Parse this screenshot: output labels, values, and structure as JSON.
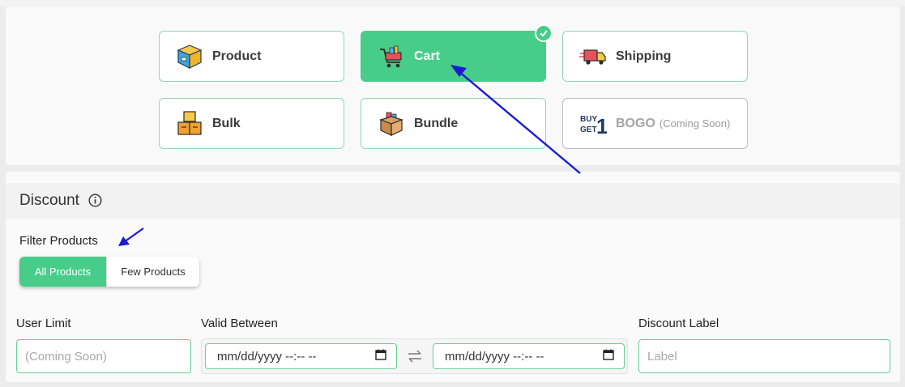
{
  "type_cards": [
    {
      "label": "Product",
      "icon": "box-icon"
    },
    {
      "label": "Cart",
      "icon": "shopping-cart-icon",
      "active": true
    },
    {
      "label": "Shipping",
      "icon": "delivery-truck-icon"
    },
    {
      "label": "Bulk",
      "icon": "stacked-boxes-icon"
    },
    {
      "label": "Bundle",
      "icon": "open-box-icon"
    },
    {
      "label": "BOGO",
      "sub": "(Coming Soon)",
      "icon": "buy-get-1-icon",
      "disabled": true
    }
  ],
  "bogo_logo_text": {
    "line1": "BUY",
    "line2": "GET",
    "digit": "1"
  },
  "discount": {
    "title": "Discount",
    "filter_label": "Filter Products",
    "filter_options": [
      "All Products",
      "Few Products"
    ],
    "selected_filter": "All Products"
  },
  "fields": {
    "user_limit": {
      "label": "User Limit",
      "placeholder": "(Coming Soon)"
    },
    "valid_between": {
      "label": "Valid Between",
      "from": "mm/dd/yyyy --:-- --",
      "to": "mm/dd/yyyy --:-- --"
    },
    "discount_label": {
      "label": "Discount Label",
      "placeholder": "Label"
    }
  },
  "colors": {
    "accent": "#47cd89",
    "border": "#8fd8b1",
    "annotation_arrow": "#1a1ad6"
  }
}
